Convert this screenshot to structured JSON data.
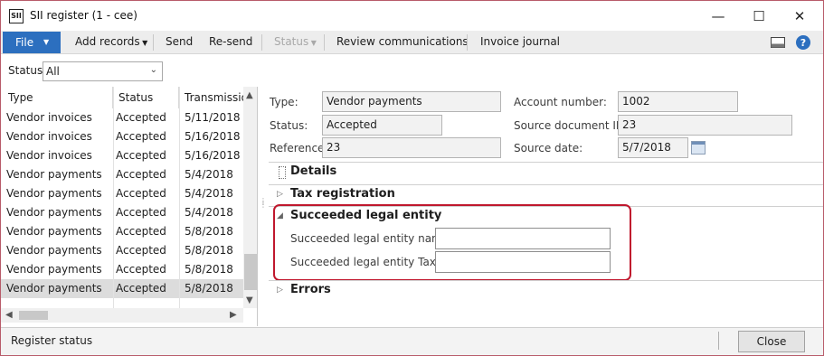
{
  "window": {
    "title": "SII register (1 - cee)",
    "icon_text": "SII",
    "controls": {
      "minimize": "—",
      "maximize": "☐",
      "close": "✕"
    }
  },
  "toolbar": {
    "file": "File",
    "add_records": "Add records",
    "send": "Send",
    "resend": "Re-send",
    "status": "Status",
    "review": "Review communications",
    "invoice_journal": "Invoice journal"
  },
  "filter": {
    "label": "Status:",
    "value": "All"
  },
  "list": {
    "headers": [
      "Type",
      "Status",
      "Transmissio"
    ],
    "rows": [
      [
        "Vendor invoices",
        "Accepted",
        "5/11/2018"
      ],
      [
        "Vendor invoices",
        "Accepted",
        "5/16/2018"
      ],
      [
        "Vendor invoices",
        "Accepted",
        "5/16/2018"
      ],
      [
        "Vendor payments",
        "Accepted",
        "5/4/2018"
      ],
      [
        "Vendor payments",
        "Accepted",
        "5/4/2018"
      ],
      [
        "Vendor payments",
        "Accepted",
        "5/4/2018"
      ],
      [
        "Vendor payments",
        "Accepted",
        "5/8/2018"
      ],
      [
        "Vendor payments",
        "Accepted",
        "5/8/2018"
      ],
      [
        "Vendor payments",
        "Accepted",
        "5/8/2018"
      ],
      [
        "Vendor payments",
        "Accepted",
        "5/8/2018"
      ]
    ],
    "selected_row": 9
  },
  "details": {
    "type_label": "Type:",
    "type_value": "Vendor payments",
    "status_label": "Status:",
    "status_value": "Accepted",
    "reference_label": "Reference:",
    "reference_value": "23",
    "account_label": "Account number:",
    "account_value": "1002",
    "srcdoc_label": "Source document ID:",
    "srcdoc_value": "23",
    "srcdate_label": "Source date:",
    "srcdate_value": "5/7/2018"
  },
  "sections": {
    "details": "Details",
    "tax": "Tax registration",
    "succeeded": "Succeeded legal entity",
    "succ_name_label": "Succeeded legal entity name:",
    "succ_name_value": "",
    "succ_taxid_label": "Succeeded legal entity Tax ID:",
    "succ_taxid_value": "",
    "errors": "Errors"
  },
  "statusbar": {
    "text": "Register status",
    "close": "Close"
  },
  "colors": {
    "file_button": "#2c6fbf",
    "highlight_border": "#c0182e",
    "window_border": "#b85b6a"
  }
}
